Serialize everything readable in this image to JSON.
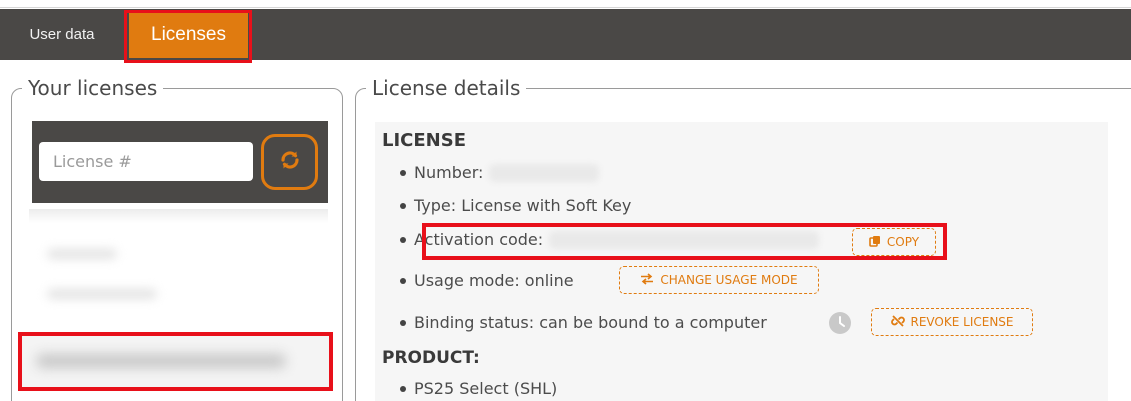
{
  "tabs": {
    "user_data": "User data",
    "licenses": "Licenses"
  },
  "left_panel": {
    "legend": "Your licenses",
    "license_input_placeholder": "License #"
  },
  "right_panel": {
    "legend": "License details",
    "license_section": {
      "heading": "LICENSE",
      "number_label": "Number:",
      "type_label": "Type: License with Soft Key",
      "activation_label": "Activation code:",
      "copy_label": "COPY",
      "usage_label": "Usage mode: online",
      "change_usage_label": "CHANGE USAGE MODE",
      "binding_label": "Binding status: can be bound to a computer",
      "revoke_label": "REVOKE LICENSE"
    },
    "product_section": {
      "heading": "PRODUCT:",
      "product_item": "PS25 Select (SHL)"
    }
  },
  "colors": {
    "accent": "#e07b10",
    "tab_bar": "#4a4846",
    "highlight": "#e8101a"
  },
  "icons": {
    "refresh": "refresh-icon",
    "copy": "copy-icon",
    "swap": "swap-arrows-icon",
    "unlink": "unlink-icon",
    "clock": "clock-icon"
  }
}
